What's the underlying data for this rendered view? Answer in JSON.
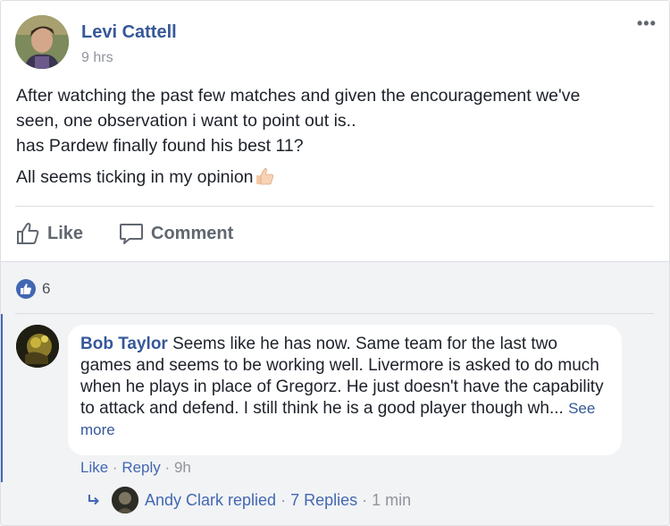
{
  "post": {
    "author": "Levi Cattell",
    "time": "9 hrs",
    "more": "•••",
    "line1": "After watching the past few matches and given the encouragement we've",
    "line2": "seen, one observation i want to point out is..",
    "line3": "has Pardew finally found his best 11?",
    "line4": "All seems ticking in my opinion"
  },
  "actions": {
    "like": "Like",
    "comment": "Comment"
  },
  "reactions": {
    "count": "6"
  },
  "comment": {
    "author": "Bob Taylor",
    "text": "Seems like he has now. Same team for the last two games and seems to be working well. Livermore is asked to do much when he plays in place of Gregorz. He just doesn't have the capability to attack and defend. I still think he is a good player though wh...",
    "see_more": "See more",
    "like": "Like",
    "reply": "Reply",
    "time": "9h",
    "sep": "·"
  },
  "replies": {
    "author_text": "Andy Clark replied",
    "count_text": "7 Replies",
    "time": "1 min",
    "sep": "·"
  },
  "colors": {
    "link": "#365899",
    "accent": "#4267b2",
    "muted": "#90949c"
  }
}
